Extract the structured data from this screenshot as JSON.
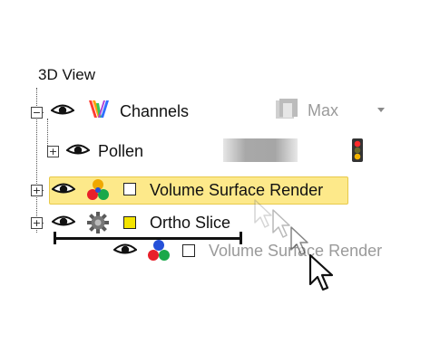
{
  "tree": {
    "root_label": "3D View",
    "channels": {
      "label": "Channels",
      "max_label": "Max"
    },
    "pollen": {
      "label": "Pollen"
    },
    "volume_surface": {
      "label": "Volume Surface Render"
    },
    "ortho_slice": {
      "label": "Ortho Slice"
    },
    "drag_ghost": {
      "label": "Volume Surface Render"
    }
  },
  "icons": {
    "eye": "eye-icon",
    "channels": "channels-icon",
    "traffic_light": "traffic-light-icon",
    "volume_render": "rgb-spheres-icon",
    "ortho": "gear-icon",
    "cursor": "mouse-cursor-icon"
  },
  "colors": {
    "highlight_bg": "#fde98a",
    "highlight_border": "#e7c94a",
    "ortho_checkbox": "#f4e400",
    "disabled_text": "#9a9a9a"
  }
}
